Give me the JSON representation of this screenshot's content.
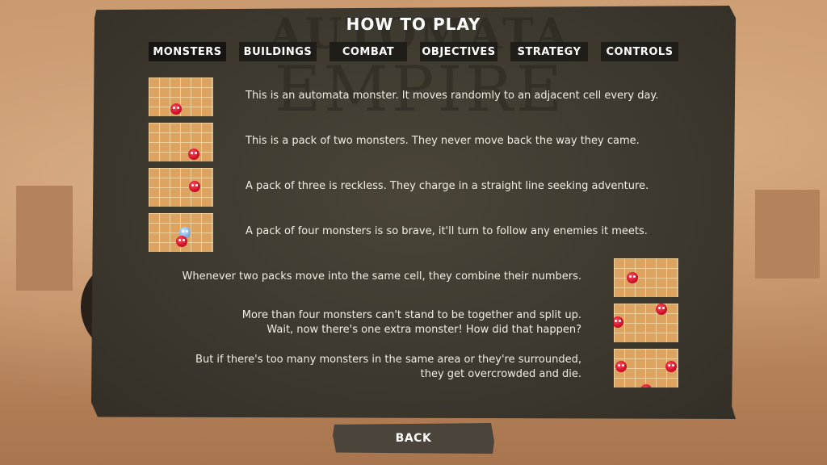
{
  "screen": {
    "title": "HOW TO PLAY",
    "watermark_line1": "AUTOMATA",
    "watermark_line2": "EMPIRE"
  },
  "tabs": [
    {
      "label": "MONSTERS",
      "active": true
    },
    {
      "label": "BUILDINGS",
      "active": false
    },
    {
      "label": "COMBAT",
      "active": false
    },
    {
      "label": "OBJECTIVES",
      "active": false
    },
    {
      "label": "STRATEGY",
      "active": false
    },
    {
      "label": "CONTROLS",
      "active": false
    }
  ],
  "rows": [
    {
      "text": "This is an automata monster. It moves randomly to an adjacent cell every day.",
      "icon": "single-monster-grid"
    },
    {
      "text": "This is a pack of two monsters. They never move back the way they came.",
      "icon": "pack-of-two-grid"
    },
    {
      "text": "A pack of three is reckless. They charge in a straight line seeking adventure.",
      "icon": "pack-of-three-grid"
    },
    {
      "text": "A pack of four monsters is so brave, it'll turn to follow any enemies it meets.",
      "icon": "pack-of-four-grid"
    },
    {
      "text": "Whenever two packs move into the same cell, they combine their numbers.",
      "icon": "combine-grid"
    },
    {
      "line1": "More than four monsters can't stand to be together and split up.",
      "line2": "Wait, now there's one extra monster! How did that happen?",
      "icon": "split-grid"
    },
    {
      "line1": "But if there's too many monsters in the same area or they're surrounded,",
      "line2": "they get overcrowded and die.",
      "icon": "overcrowded-grid"
    }
  ],
  "back_button": {
    "label": "BACK"
  },
  "colors": {
    "panel": "#3e3a30",
    "tab_bg": "#1f1d18",
    "text": "#f2ede2",
    "monster_red": "#d0102a",
    "monster_blue": "#7fb0e6",
    "grid_tile": "#dca460"
  }
}
